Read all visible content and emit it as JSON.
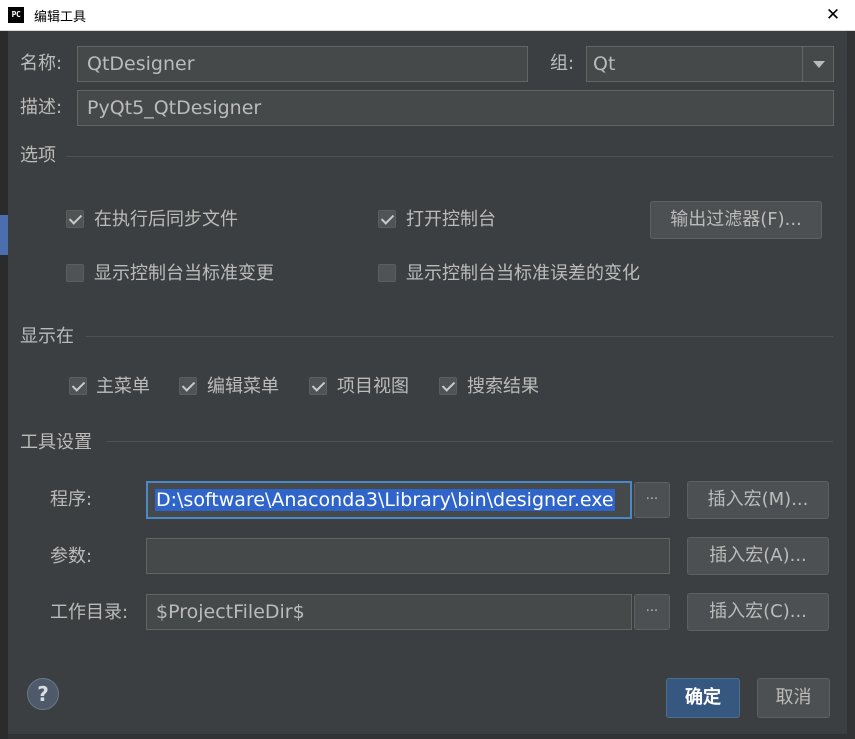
{
  "window": {
    "icon_text": "PC",
    "title": "编辑工具",
    "close_glyph": "✕"
  },
  "general": {
    "name_label": "名称:",
    "name_value": "QtDesigner",
    "group_label": "组:",
    "group_value": "Qt",
    "desc_label": "描述:",
    "desc_value": "PyQt5_QtDesigner"
  },
  "options": {
    "section_title": "选项",
    "sync_files": {
      "label": "在执行后同步文件",
      "checked": true
    },
    "open_console": {
      "label": "打开控制台",
      "checked": true
    },
    "output_filters_button": "输出过滤器(F)...",
    "show_console_stdout": {
      "label": "显示控制台当标准变更",
      "checked": false
    },
    "show_console_stderr": {
      "label": "显示控制台当标准误差的变化",
      "checked": false
    }
  },
  "show_in": {
    "section_title": "显示在",
    "items": [
      {
        "label": "主菜单",
        "checked": true
      },
      {
        "label": "编辑菜单",
        "checked": true
      },
      {
        "label": "项目视图",
        "checked": true
      },
      {
        "label": "搜索结果",
        "checked": true
      }
    ]
  },
  "tool_settings": {
    "section_title": "工具设置",
    "program_label": "程序:",
    "program_value": "D:\\software\\Anaconda3\\Library\\bin\\designer.exe",
    "args_label": "参数:",
    "args_value": "",
    "workdir_label": "工作目录:",
    "workdir_value": "$ProjectFileDir$",
    "browse_label": "···",
    "insert_macro_m": "插入宏(M)...",
    "insert_macro_a": "插入宏(A)...",
    "insert_macro_c": "插入宏(C)..."
  },
  "footer": {
    "help_glyph": "?",
    "ok_button": "确定",
    "cancel_button": "取消"
  },
  "colors": {
    "background": "#3c3f41",
    "accent": "#4a88c7",
    "primary_button": "#365880",
    "selection": "#2f65ca"
  }
}
